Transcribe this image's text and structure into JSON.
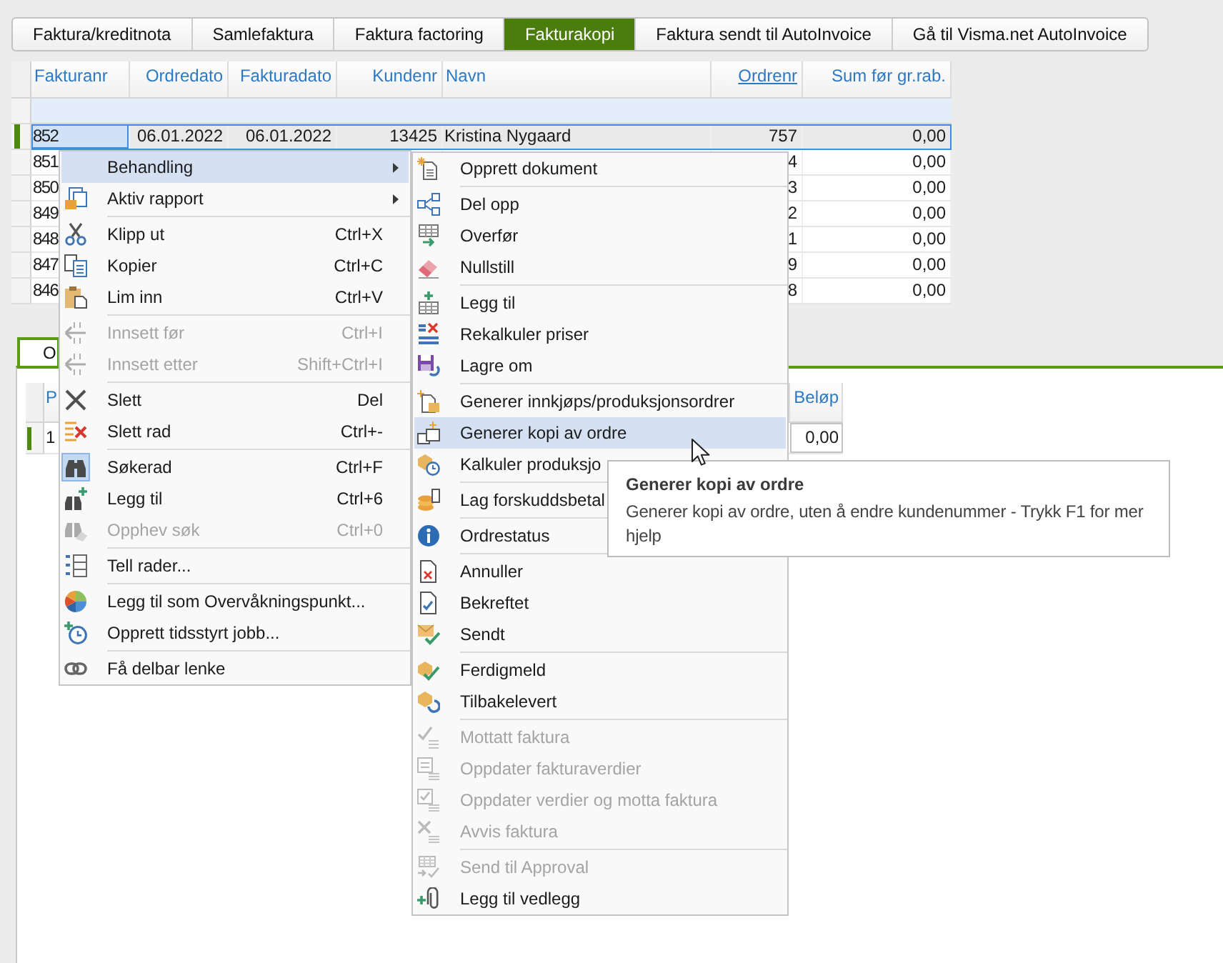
{
  "tabs": [
    {
      "label": "Faktura/kreditnota",
      "selected": false
    },
    {
      "label": "Samlefaktura",
      "selected": false
    },
    {
      "label": "Faktura factoring",
      "selected": false
    },
    {
      "label": "Fakturakopi",
      "selected": true
    },
    {
      "label": "Faktura sendt til AutoInvoice",
      "selected": false
    },
    {
      "label": "Gå til Visma.net AutoInvoice",
      "selected": false
    }
  ],
  "table": {
    "columns": [
      {
        "label": "Fakturanr",
        "sorted": false
      },
      {
        "label": "Ordredato",
        "sorted": false
      },
      {
        "label": "Fakturadato",
        "sorted": false
      },
      {
        "label": "Kundenr",
        "sorted": false
      },
      {
        "label": "Navn",
        "sorted": false
      },
      {
        "label": "Ordrenr",
        "sorted": true
      },
      {
        "label": "Sum før gr.rab.",
        "sorted": false
      }
    ],
    "rows": [
      {
        "selected": true,
        "fakturanr": "852",
        "ordredato": "06.01.2022",
        "fakturadato": "06.01.2022",
        "kundenr": "13425",
        "navn": "Kristina Nygaard",
        "ordrenr": "757",
        "sum_for_gr_rab": "0,00"
      },
      {
        "selected": false,
        "fakturanr": "851",
        "ordrenr": "4",
        "sum_for_gr_rab": "0,00"
      },
      {
        "selected": false,
        "fakturanr": "850",
        "ordrenr": "3",
        "sum_for_gr_rab": "0,00"
      },
      {
        "selected": false,
        "fakturanr": "849",
        "ordrenr": "2",
        "sum_for_gr_rab": "0,00"
      },
      {
        "selected": false,
        "fakturanr": "848",
        "ordrenr": "1",
        "sum_for_gr_rab": "0,00"
      },
      {
        "selected": false,
        "fakturanr": "847",
        "ordrenr": "9",
        "sum_for_gr_rab": "0,00"
      },
      {
        "selected": false,
        "fakturanr": "846",
        "ordrenr": "8",
        "sum_for_gr_rab": "0,00"
      }
    ]
  },
  "detail_panel": {
    "tabs": [
      {
        "label": "O",
        "selected": true
      }
    ],
    "grid": {
      "columns": [
        {
          "label": "P"
        },
        {
          "label": "Beløp"
        }
      ],
      "rows": [
        {
          "selected": true,
          "cells": [
            "1",
            "0,00"
          ]
        }
      ]
    }
  },
  "context_menu": {
    "sections": [
      {
        "items": [
          {
            "label": "Behandling",
            "submenu": true,
            "selected": true,
            "disabled": false,
            "checked": false
          },
          {
            "label": "Aktiv rapport",
            "submenu": true,
            "selected": false,
            "disabled": false,
            "checked": false
          }
        ]
      },
      {
        "items": [
          {
            "label": "Klipp ut",
            "shortcut": "Ctrl+X",
            "submenu": false,
            "selected": false,
            "disabled": false,
            "checked": false
          },
          {
            "label": "Kopier",
            "shortcut": "Ctrl+C",
            "submenu": false,
            "selected": false,
            "disabled": false,
            "checked": false
          },
          {
            "label": "Lim inn",
            "shortcut": "Ctrl+V",
            "submenu": false,
            "selected": false,
            "disabled": false,
            "checked": false
          }
        ]
      },
      {
        "items": [
          {
            "label": "Innsett før",
            "shortcut": "Ctrl+I",
            "submenu": false,
            "selected": false,
            "disabled": true,
            "checked": false
          },
          {
            "label": "Innsett etter",
            "shortcut": "Shift+Ctrl+I",
            "submenu": false,
            "selected": false,
            "disabled": true,
            "checked": false
          }
        ]
      },
      {
        "items": [
          {
            "label": "Slett",
            "shortcut": "Del",
            "submenu": false,
            "selected": false,
            "disabled": false,
            "checked": false
          },
          {
            "label": "Slett rad",
            "shortcut": "Ctrl+-",
            "submenu": false,
            "selected": false,
            "disabled": false,
            "checked": false
          }
        ]
      },
      {
        "items": [
          {
            "label": "Søkerad",
            "shortcut": "Ctrl+F",
            "submenu": false,
            "selected": false,
            "disabled": false,
            "checked": true
          },
          {
            "label": "Legg til",
            "shortcut": "Ctrl+6",
            "submenu": false,
            "selected": false,
            "disabled": false,
            "checked": false
          },
          {
            "label": "Opphev søk",
            "shortcut": "Ctrl+0",
            "submenu": false,
            "selected": false,
            "disabled": true,
            "checked": false
          }
        ]
      },
      {
        "items": [
          {
            "label": "Tell rader...",
            "submenu": false,
            "selected": false,
            "disabled": false,
            "checked": false
          }
        ]
      },
      {
        "items": [
          {
            "label": "Legg til som Overvåkningspunkt...",
            "submenu": false,
            "selected": false,
            "disabled": false,
            "checked": false
          },
          {
            "label": "Opprett tidsstyrt jobb...",
            "submenu": false,
            "selected": false,
            "disabled": false,
            "checked": false
          }
        ]
      },
      {
        "items": [
          {
            "label": "Få delbar lenke",
            "submenu": false,
            "selected": false,
            "disabled": false,
            "checked": false
          }
        ]
      }
    ]
  },
  "submenu": {
    "sections": [
      {
        "items": [
          {
            "label": "Opprett dokument",
            "selected": false,
            "disabled": false
          }
        ]
      },
      {
        "items": [
          {
            "label": "Del opp",
            "selected": false,
            "disabled": false
          },
          {
            "label": "Overfør",
            "selected": false,
            "disabled": false
          },
          {
            "label": "Nullstill",
            "selected": false,
            "disabled": false
          }
        ]
      },
      {
        "items": [
          {
            "label": "Legg til",
            "selected": false,
            "disabled": false
          },
          {
            "label": "Rekalkuler priser",
            "selected": false,
            "disabled": false
          },
          {
            "label": "Lagre om",
            "selected": false,
            "disabled": false
          }
        ]
      },
      {
        "items": [
          {
            "label": "Generer innkjøps/produksjonsordrer",
            "selected": false,
            "disabled": false
          },
          {
            "label": "Generer kopi av ordre",
            "selected": true,
            "disabled": false
          },
          {
            "label": "Kalkuler produksjo",
            "selected": false,
            "disabled": false
          }
        ]
      },
      {
        "items": [
          {
            "label": "Lag forskuddsbetal",
            "selected": false,
            "disabled": false
          }
        ]
      },
      {
        "items": [
          {
            "label": "Ordrestatus",
            "selected": false,
            "disabled": false
          }
        ]
      },
      {
        "items": [
          {
            "label": "Annuller",
            "selected": false,
            "disabled": false
          },
          {
            "label": "Bekreftet",
            "selected": false,
            "disabled": false
          },
          {
            "label": "Sendt",
            "selected": false,
            "disabled": false
          }
        ]
      },
      {
        "items": [
          {
            "label": "Ferdigmeld",
            "selected": false,
            "disabled": false
          },
          {
            "label": "Tilbakelevert",
            "selected": false,
            "disabled": false
          }
        ]
      },
      {
        "items": [
          {
            "label": "Mottatt faktura",
            "selected": false,
            "disabled": true
          },
          {
            "label": "Oppdater fakturaverdier",
            "selected": false,
            "disabled": true
          },
          {
            "label": "Oppdater verdier og motta faktura",
            "selected": false,
            "disabled": true
          },
          {
            "label": "Avvis faktura",
            "selected": false,
            "disabled": true
          }
        ]
      },
      {
        "items": [
          {
            "label": "Send til Approval",
            "selected": false,
            "disabled": true
          },
          {
            "label": "Legg til vedlegg",
            "selected": false,
            "disabled": false
          }
        ]
      }
    ]
  },
  "tooltip": {
    "title": "Generer kopi av ordre",
    "text": "Generer kopi av ordre, uten å endre kundenummer - Trykk F1 for mer hjelp"
  }
}
